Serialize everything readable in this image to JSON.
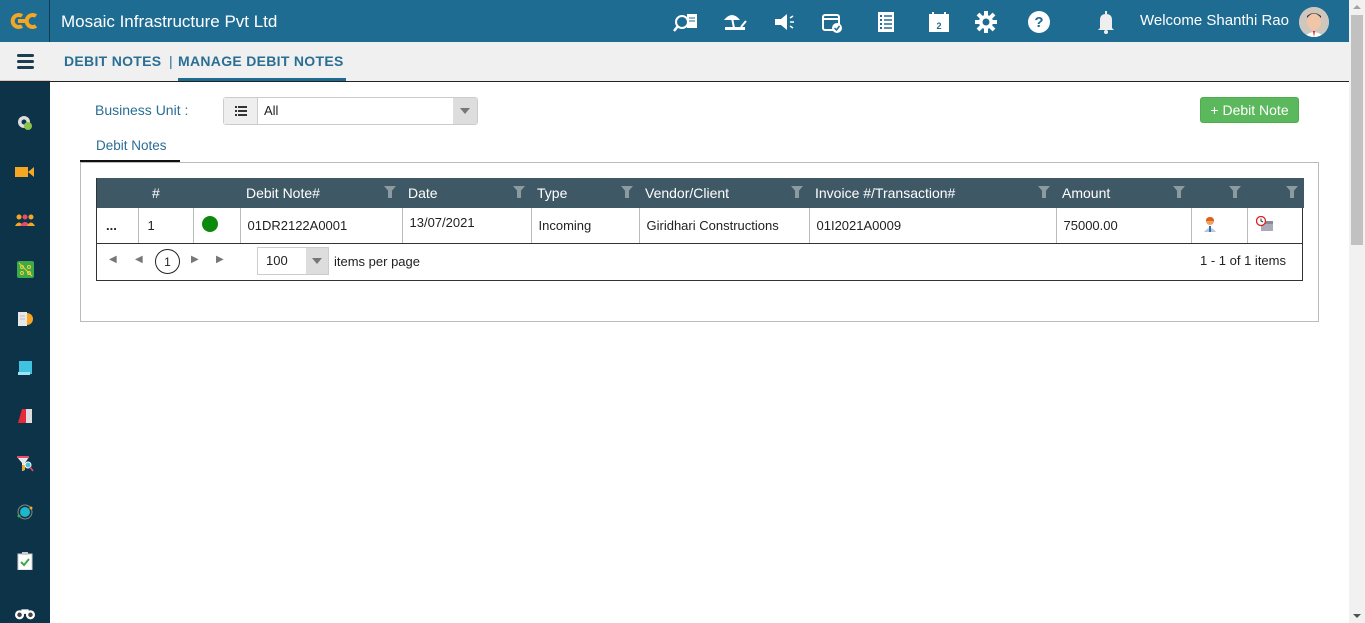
{
  "header": {
    "company": "Mosaic Infrastructure Pvt Ltd",
    "welcome": "Welcome Shanthi Rao",
    "colors": {
      "brand": "#1f6c93",
      "sidebar": "#0d3349",
      "logo": "#f5a623"
    },
    "icons": [
      "search-document-icon",
      "beach-leave-icon",
      "megaphone-icon",
      "calendar-check-icon",
      "checklist-icon",
      "calendar-icon",
      "gear-icon",
      "help-icon",
      "bell-icon"
    ]
  },
  "breadcrumb": {
    "root": "DEBIT NOTES",
    "separator": "|",
    "current": "MANAGE DEBIT NOTES"
  },
  "sidebar": {
    "items": [
      "settings-user-icon",
      "video-icon",
      "team-icon",
      "network-icon",
      "report-icon",
      "notes-icon",
      "document-icon",
      "filter-search-icon",
      "orbit-icon",
      "clipboard-check-icon",
      "binoculars-icon"
    ]
  },
  "filters": {
    "business_unit_label": "Business Unit :",
    "business_unit_value": "All"
  },
  "actions": {
    "add_label": "+ Debit Note",
    "add_color": "#5cb85c"
  },
  "tabs": [
    {
      "label": "Debit Notes",
      "active": true
    }
  ],
  "grid": {
    "columns": [
      "",
      "#",
      "",
      "Debit Note#",
      "Date",
      "Type",
      "Vendor/Client",
      "Invoice #/Transaction#",
      "Amount",
      "",
      ""
    ],
    "rows": [
      {
        "menu": "...",
        "index": "1",
        "status_color": "#0a8a0a",
        "debit_note": "01DR2122A0001",
        "date": "13/07/2021",
        "type": "Incoming",
        "vendor": "Giridhari Constructions",
        "invoice": "01I2021A0009",
        "amount": "75000.00"
      }
    ],
    "pager": {
      "current_page": "1",
      "page_size": "100",
      "page_size_label": "items per page",
      "info": "1 - 1 of 1 items"
    }
  }
}
